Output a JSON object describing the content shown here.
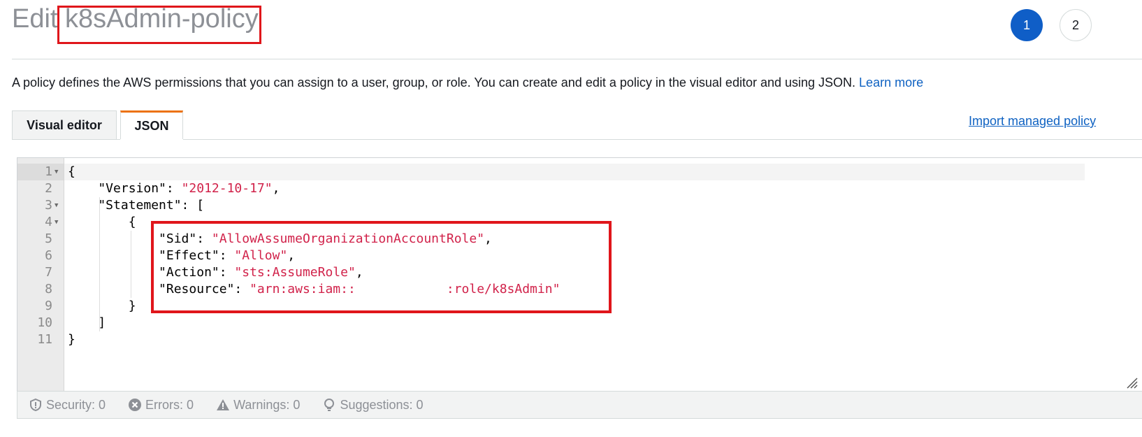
{
  "page": {
    "title_prefix": "Edit",
    "title_name": "k8sAdmin-policy",
    "description": "A policy defines the AWS permissions that you can assign to a user, group, or role. You can create and edit a policy in the visual editor and using JSON.",
    "learn_more": "Learn more"
  },
  "steps": [
    "1",
    "2"
  ],
  "tabs": {
    "visual": "Visual editor",
    "json": "JSON"
  },
  "import_link": "Import managed policy",
  "editor": {
    "line_numbers": [
      "1",
      "2",
      "3",
      "4",
      "5",
      "6",
      "7",
      "8",
      "9",
      "10",
      "11"
    ],
    "lines": {
      "l1": "{",
      "l2_key": "    \"Version\": ",
      "l2_val": "\"2012-10-17\"",
      "l2_end": ",",
      "l3": "    \"Statement\": [",
      "l4": "        {",
      "l5_key": "            \"Sid\": ",
      "l5_val": "\"AllowAssumeOrganizationAccountRole\"",
      "l5_end": ",",
      "l6_key": "            \"Effect\": ",
      "l6_val": "\"Allow\"",
      "l6_end": ",",
      "l7_key": "            \"Action\": ",
      "l7_val": "\"sts:AssumeRole\"",
      "l7_end": ",",
      "l8_key": "            \"Resource\": ",
      "l8_val": "\"arn:aws:iam::            :role/k8sAdmin\"",
      "l9": "        }",
      "l10": "    ]",
      "l11": "}"
    }
  },
  "status": {
    "security": "Security: 0",
    "errors": "Errors: 0",
    "warnings": "Warnings: 0",
    "suggestions": "Suggestions: 0"
  },
  "colors": {
    "accent": "#0f5ec7",
    "tab_active": "#ec7211",
    "string": "#d1224a",
    "highlight": "#e0161b"
  }
}
